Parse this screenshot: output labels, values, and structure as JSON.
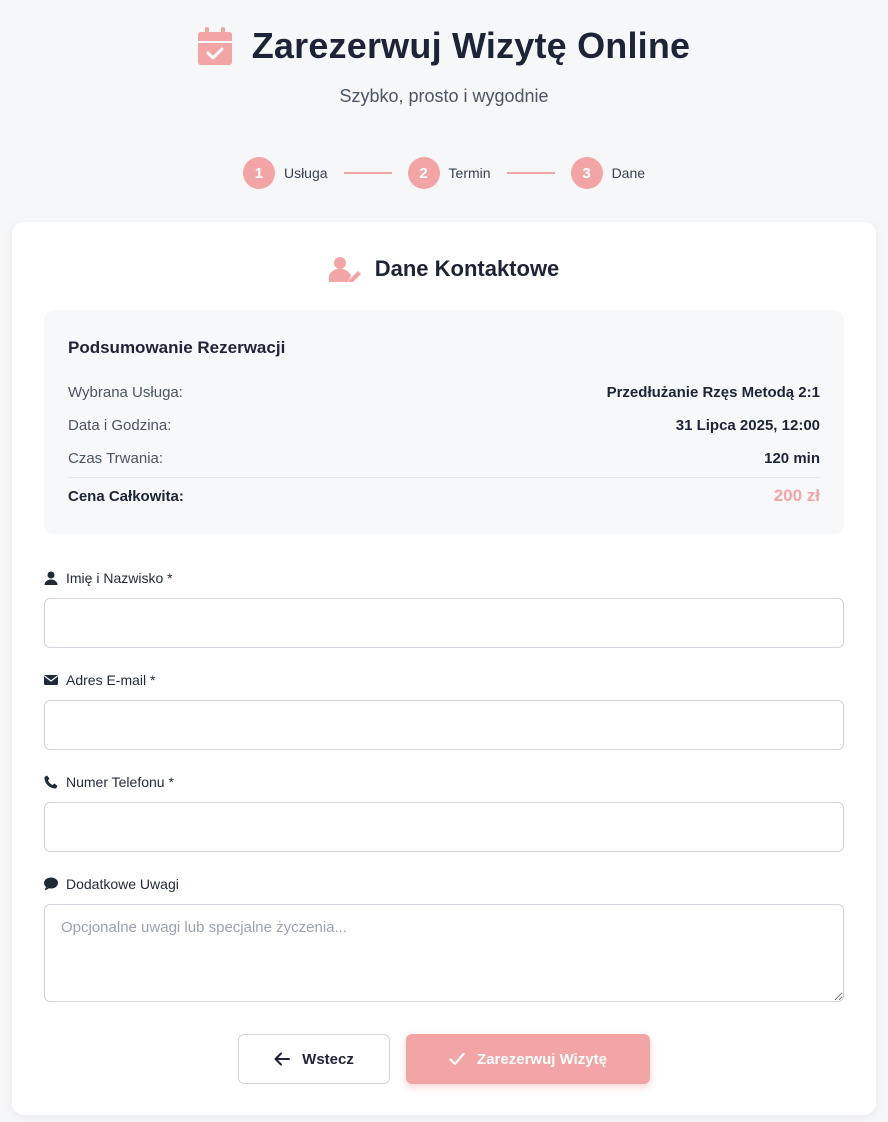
{
  "header": {
    "title": "Zarezerwuj Wizytę Online",
    "subtitle": "Szybko, prosto i wygodnie"
  },
  "steps": [
    {
      "num": "1",
      "label": "Usługa"
    },
    {
      "num": "2",
      "label": "Termin"
    },
    {
      "num": "3",
      "label": "Dane"
    }
  ],
  "section": {
    "title": "Dane Kontaktowe"
  },
  "summary": {
    "heading": "Podsumowanie Rezerwacji",
    "rows": [
      {
        "key": "Wybrana Usługa:",
        "value": "Przedłużanie Rzęs Metodą 2:1"
      },
      {
        "key": "Data i Godzina:",
        "value": "31 Lipca 2025, 12:00"
      },
      {
        "key": "Czas Trwania:",
        "value": "120 min"
      }
    ],
    "total_key": "Cena Całkowita:",
    "total_value": "200 zł"
  },
  "form": {
    "name_label": "Imię i Nazwisko *",
    "email_label": "Adres E-mail *",
    "phone_label": "Numer Telefonu *",
    "notes_label": "Dodatkowe Uwagi",
    "notes_placeholder": "Opcjonalne uwagi lub specjalne życzenia..."
  },
  "buttons": {
    "back_label": "Wstecz",
    "submit_label": "Zarezerwuj Wizytę"
  },
  "colors": {
    "accent": "#f3a5a5",
    "text_dark": "#1e2437",
    "background": "#f6f7f9"
  }
}
